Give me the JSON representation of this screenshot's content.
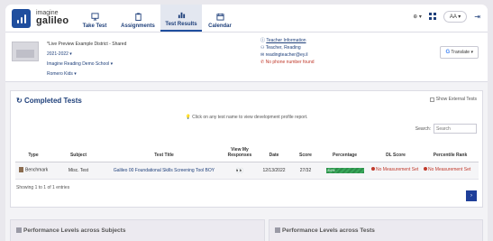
{
  "brand": {
    "line1": "imagine",
    "line2": "galileo"
  },
  "nav": [
    {
      "label": "Take Test",
      "icon": "monitor-icon"
    },
    {
      "label": "Assignments",
      "icon": "clipboard-icon"
    },
    {
      "label": "Test Results",
      "icon": "bar-chart-icon",
      "active": true
    },
    {
      "label": "Calendar",
      "icon": "calendar-icon"
    }
  ],
  "user": {
    "initials": "AA"
  },
  "context": {
    "district": "*Live Preview Example District - Shared",
    "year": "2021-2022",
    "school": "Imagine Reading Demo School",
    "group": "Romero Kids"
  },
  "teacher": {
    "info": "Teacher Information",
    "name": "Teacher, Reading",
    "email": "readingteacher@ey.il",
    "phone": "No phone number found"
  },
  "translate_label": "Translate",
  "panel": {
    "title": "Completed Tests",
    "show_external": "Show External Tests",
    "hint": "Click on any test name to view development profile report.",
    "search_label": "Search:",
    "search_placeholder": "Search"
  },
  "table": {
    "headers": [
      "Type",
      "Subject",
      "Test Title",
      "View My Responses",
      "Date",
      "Score",
      "Percentage",
      "DL Score",
      "Percentile Rank"
    ],
    "rows": [
      {
        "type": "Benchmark",
        "subject": "Misc. Test",
        "title": "Galileo 00 Foundational Skills Screening Tool BOY",
        "date": "12/13/2022",
        "score": "27/32",
        "percentage": "84%",
        "dl_score": "No Measurement Set",
        "percentile": "No Measurement Set"
      }
    ]
  },
  "showing": "Showing 1 to 1 of 1 entries",
  "bottom": {
    "left_title": "Performance Levels across Subjects",
    "right_title": "Performance Levels across Tests"
  }
}
